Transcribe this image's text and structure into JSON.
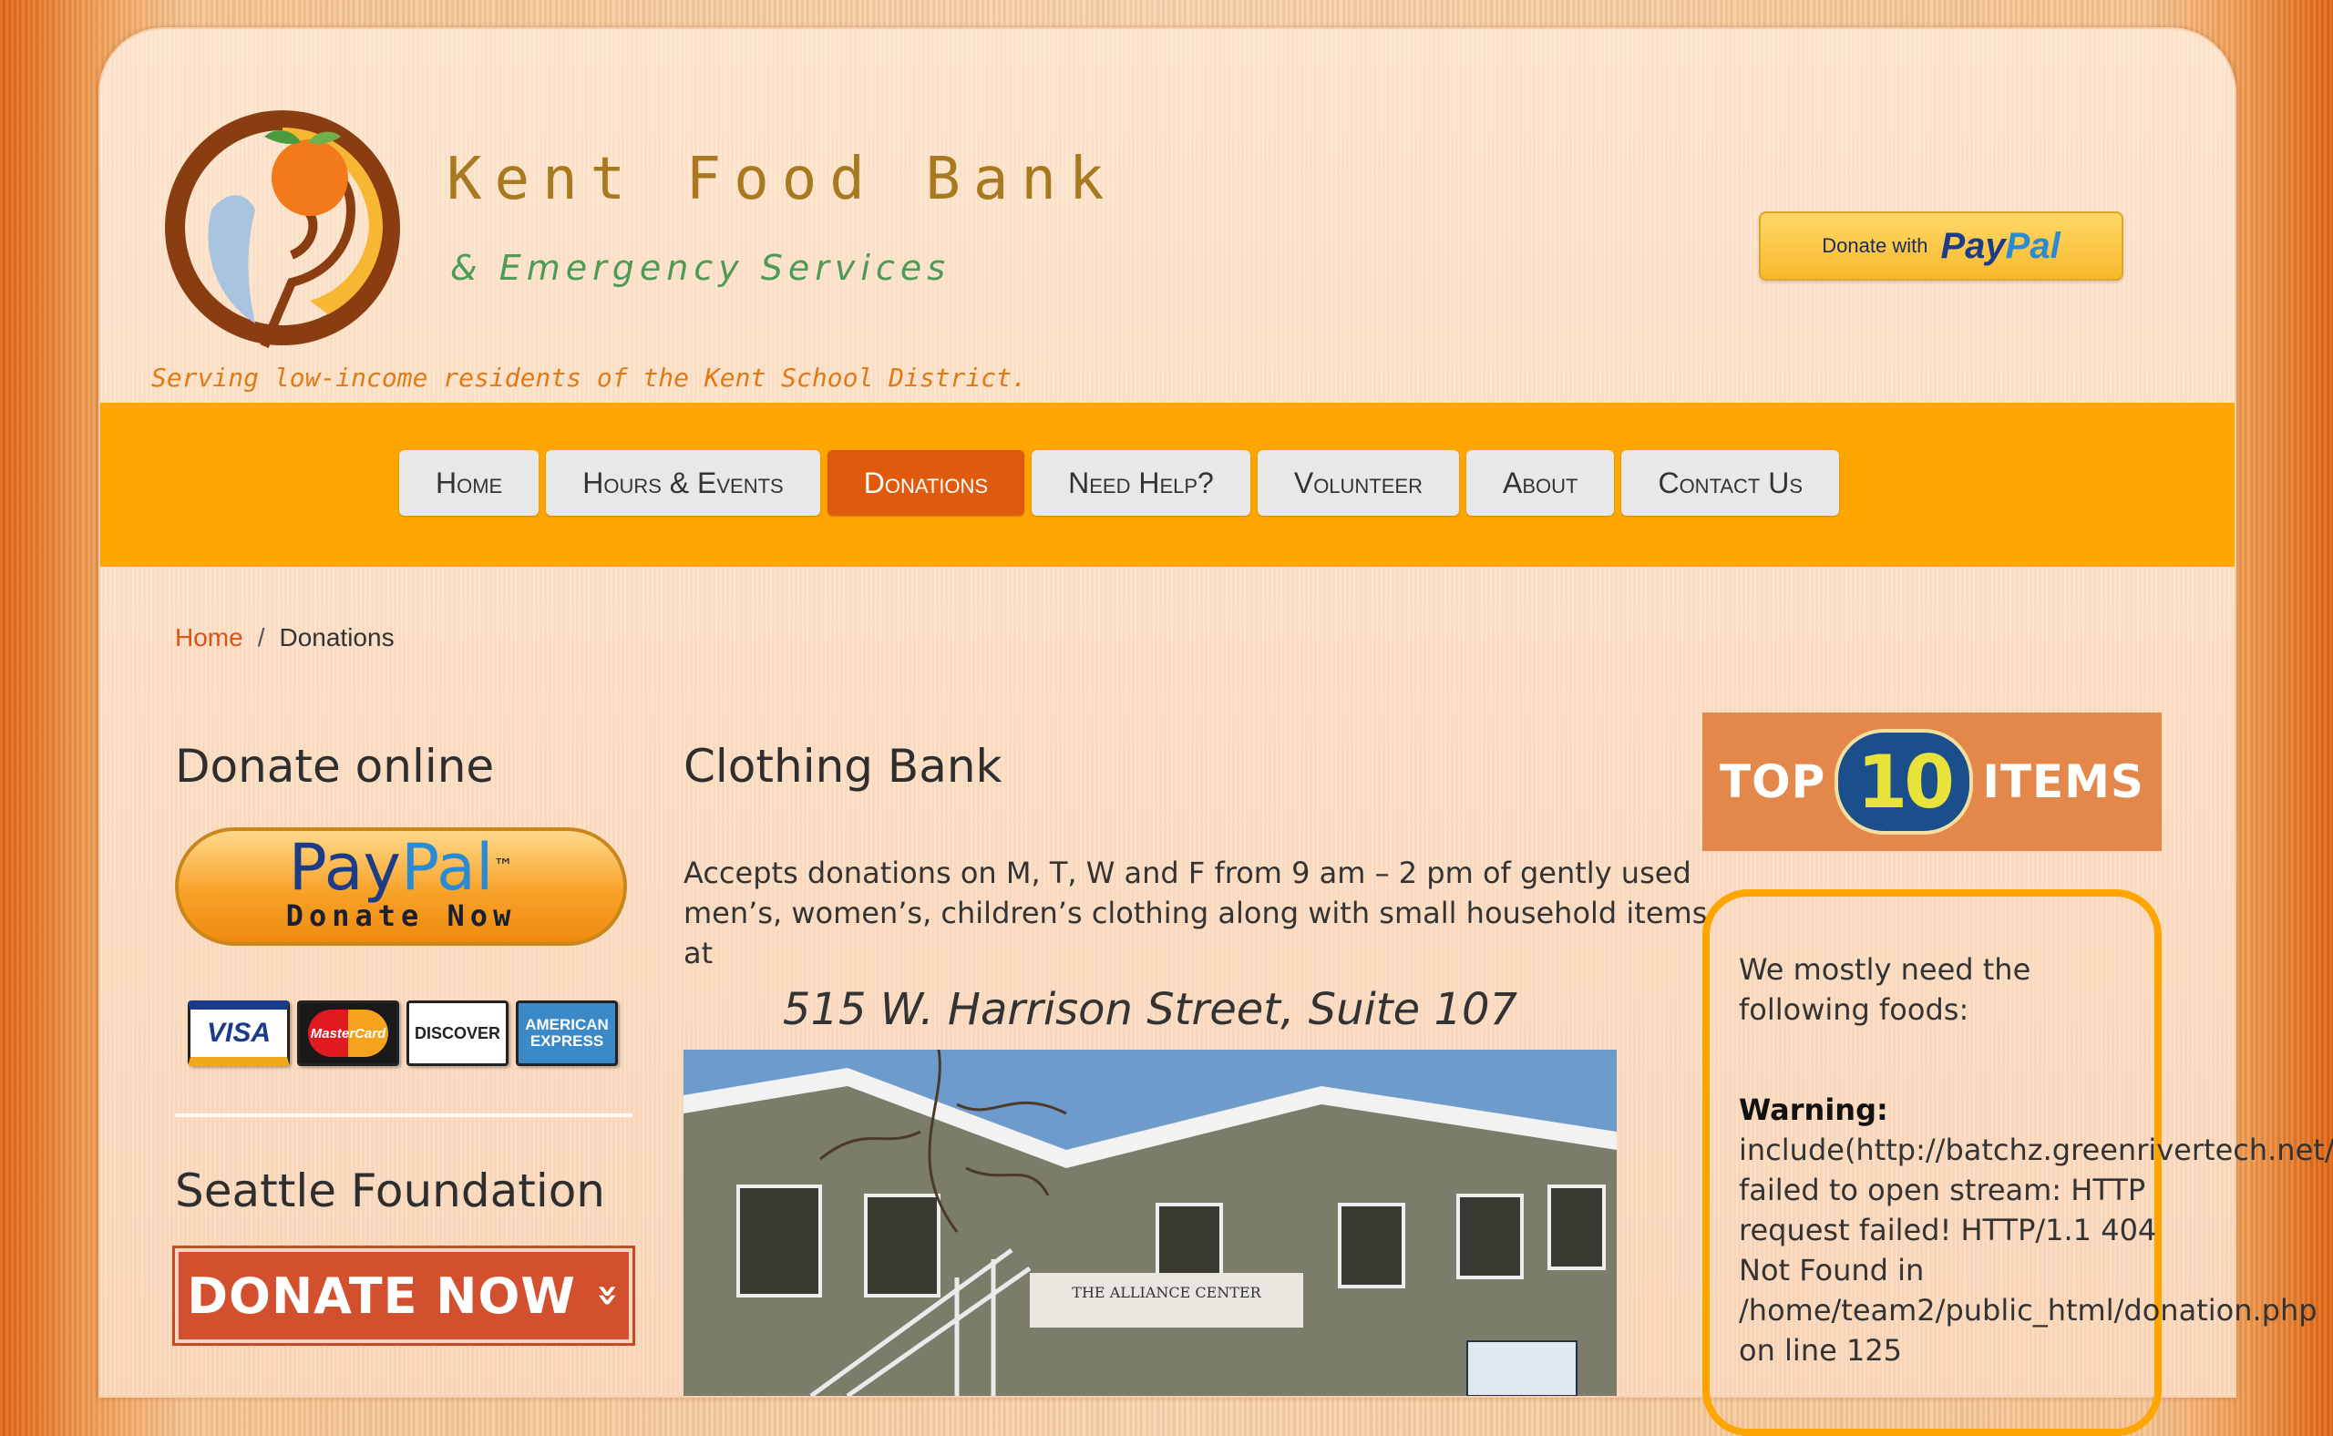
{
  "brand": {
    "title": "Kent Food Bank",
    "subtitle": "& Emergency Services",
    "tagline": "Serving low-income residents of the Kent School District."
  },
  "header": {
    "paypal_with": "Donate with",
    "paypal_pay": "Pay",
    "paypal_pal": "Pal"
  },
  "nav": {
    "items": [
      {
        "label": "Home"
      },
      {
        "label": "Hours & Events"
      },
      {
        "label": "Donations",
        "active": true
      },
      {
        "label": "Need Help?"
      },
      {
        "label": "Volunteer"
      },
      {
        "label": "About"
      },
      {
        "label": "Contact Us"
      }
    ]
  },
  "breadcrumb": {
    "home": "Home",
    "separator": "/",
    "current": "Donations"
  },
  "left": {
    "donate_online": "Donate online",
    "paypal_pay": "Pay",
    "paypal_pal": "Pal",
    "paypal_tm": "™",
    "paypal_donate_now": "Donate Now",
    "cards": {
      "visa": "VISA",
      "mastercard": "MasterCard",
      "discover": "DISCOVER",
      "amex": "AMERICAN EXPRESS"
    },
    "seattle_foundation": "Seattle Foundation",
    "donate_now_button": "DONATE NOW",
    "donate_now_chevron": "»"
  },
  "main": {
    "heading": "Clothing Bank",
    "paragraph": "Accepts donations on M, T, W and F from 9 am – 2 pm of gently used men’s, women’s, children’s clothing along with small household items at",
    "address": "515 W. Harrison Street, Suite 107",
    "photo_sign": "THE ALLIANCE CENTER"
  },
  "right": {
    "top10_left": "TOP",
    "top10_num": "10",
    "top10_right": "ITEMS",
    "need_text": "We mostly need the following foods:",
    "warning_label": "Warning:",
    "warning_lines": [
      "include(http://batchz.greenrivertech.net/Inc",
      "failed to open stream: HTTP",
      "request failed! HTTP/1.1 404",
      "Not Found in",
      "/home/team2/public_html/donation.php",
      "on line 125"
    ]
  },
  "colors": {
    "nav_bar": "#ffa500",
    "nav_active": "#e05a0d",
    "link": "#d9551a"
  }
}
